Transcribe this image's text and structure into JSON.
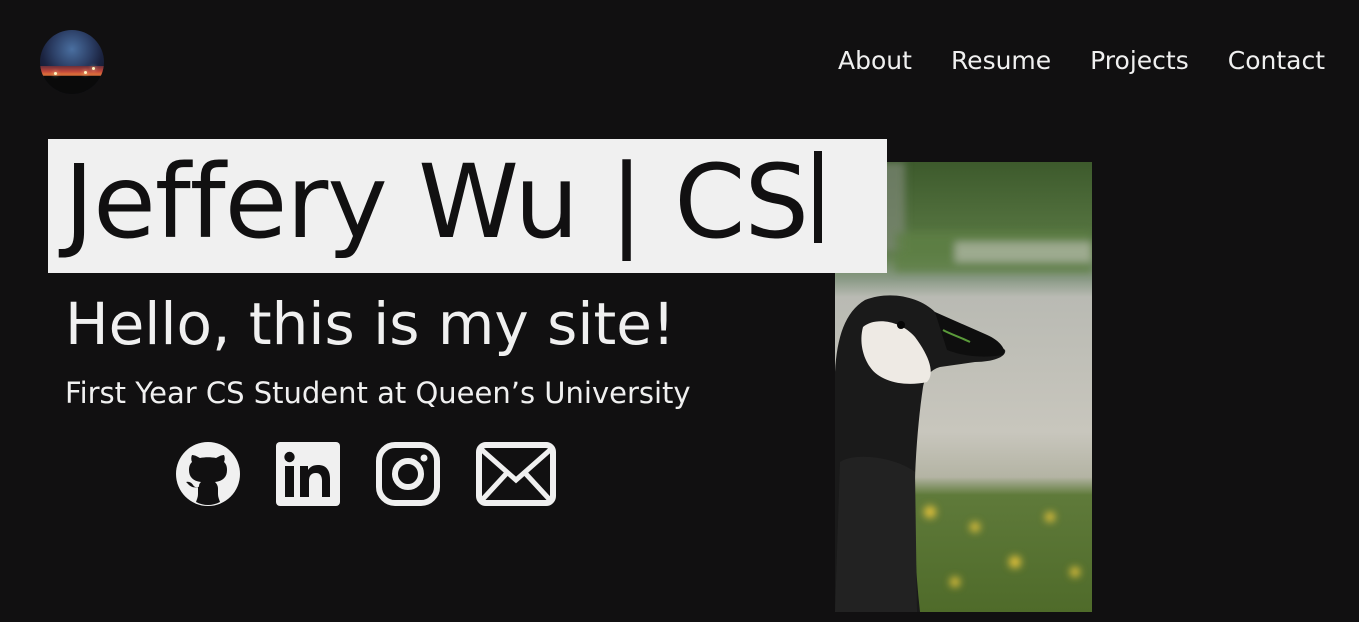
{
  "header": {
    "avatar_icon": "sunset-avatar-photo",
    "nav": [
      {
        "label": "About"
      },
      {
        "label": "Resume"
      },
      {
        "label": "Projects"
      },
      {
        "label": "Contact"
      }
    ]
  },
  "hero": {
    "title": "Jeffery Wu | CS",
    "greeting": "Hello, this is my site!",
    "subtitle": "First Year CS Student at Queen’s University",
    "socials": [
      {
        "icon": "github-icon"
      },
      {
        "icon": "linkedin-icon"
      },
      {
        "icon": "instagram-icon"
      },
      {
        "icon": "email-icon"
      }
    ],
    "photo": "canada-goose-photo"
  },
  "colors": {
    "background": "#111011",
    "text": "#f0f0f0",
    "title_box": "#f0f0f0"
  }
}
